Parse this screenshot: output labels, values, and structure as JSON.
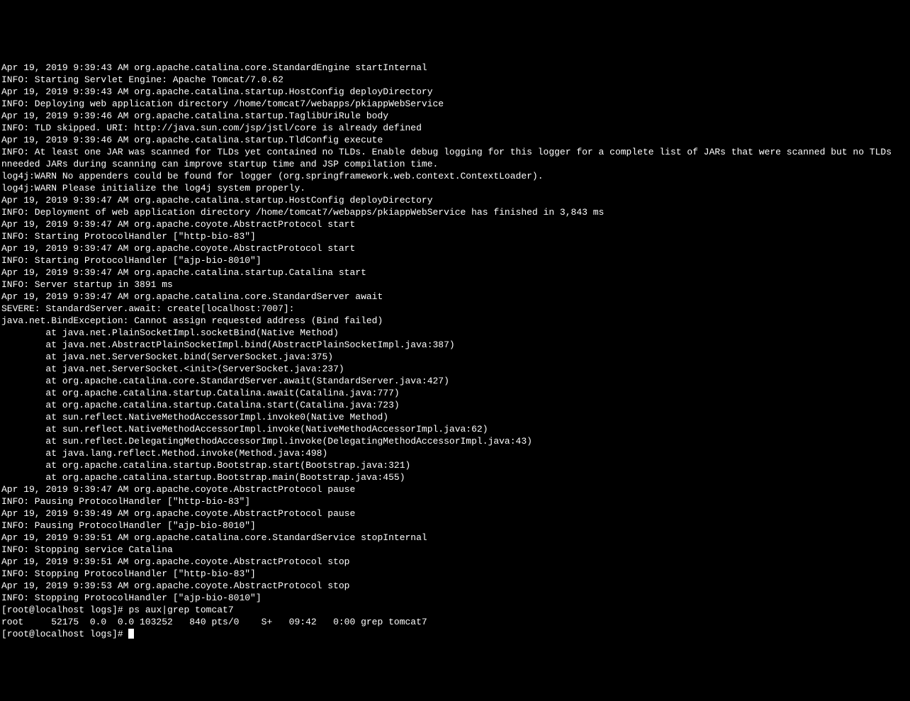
{
  "lines": [
    "Apr 19, 2019 9:39:43 AM org.apache.catalina.core.StandardEngine startInternal",
    "INFO: Starting Servlet Engine: Apache Tomcat/7.0.62",
    "Apr 19, 2019 9:39:43 AM org.apache.catalina.startup.HostConfig deployDirectory",
    "INFO: Deploying web application directory /home/tomcat7/webapps/pkiappWebService",
    "Apr 19, 2019 9:39:46 AM org.apache.catalina.startup.TaglibUriRule body",
    "INFO: TLD skipped. URI: http://java.sun.com/jsp/jstl/core is already defined",
    "Apr 19, 2019 9:39:46 AM org.apache.catalina.startup.TldConfig execute",
    "INFO: At least one JAR was scanned for TLDs yet contained no TLDs. Enable debug logging for this logger for a complete list of JARs that were scanned but no TLDs",
    "nneeded JARs during scanning can improve startup time and JSP compilation time.",
    "log4j:WARN No appenders could be found for logger (org.springframework.web.context.ContextLoader).",
    "log4j:WARN Please initialize the log4j system properly.",
    "Apr 19, 2019 9:39:47 AM org.apache.catalina.startup.HostConfig deployDirectory",
    "INFO: Deployment of web application directory /home/tomcat7/webapps/pkiappWebService has finished in 3,843 ms",
    "Apr 19, 2019 9:39:47 AM org.apache.coyote.AbstractProtocol start",
    "INFO: Starting ProtocolHandler [\"http-bio-83\"]",
    "Apr 19, 2019 9:39:47 AM org.apache.coyote.AbstractProtocol start",
    "INFO: Starting ProtocolHandler [\"ajp-bio-8010\"]",
    "Apr 19, 2019 9:39:47 AM org.apache.catalina.startup.Catalina start",
    "INFO: Server startup in 3891 ms",
    "Apr 19, 2019 9:39:47 AM org.apache.catalina.core.StandardServer await",
    "SEVERE: StandardServer.await: create[localhost:7007]:",
    "java.net.BindException: Cannot assign requested address (Bind failed)",
    "        at java.net.PlainSocketImpl.socketBind(Native Method)",
    "        at java.net.AbstractPlainSocketImpl.bind(AbstractPlainSocketImpl.java:387)",
    "        at java.net.ServerSocket.bind(ServerSocket.java:375)",
    "        at java.net.ServerSocket.<init>(ServerSocket.java:237)",
    "        at org.apache.catalina.core.StandardServer.await(StandardServer.java:427)",
    "        at org.apache.catalina.startup.Catalina.await(Catalina.java:777)",
    "        at org.apache.catalina.startup.Catalina.start(Catalina.java:723)",
    "        at sun.reflect.NativeMethodAccessorImpl.invoke0(Native Method)",
    "        at sun.reflect.NativeMethodAccessorImpl.invoke(NativeMethodAccessorImpl.java:62)",
    "        at sun.reflect.DelegatingMethodAccessorImpl.invoke(DelegatingMethodAccessorImpl.java:43)",
    "        at java.lang.reflect.Method.invoke(Method.java:498)",
    "        at org.apache.catalina.startup.Bootstrap.start(Bootstrap.java:321)",
    "        at org.apache.catalina.startup.Bootstrap.main(Bootstrap.java:455)",
    "",
    "Apr 19, 2019 9:39:47 AM org.apache.coyote.AbstractProtocol pause",
    "INFO: Pausing ProtocolHandler [\"http-bio-83\"]",
    "Apr 19, 2019 9:39:49 AM org.apache.coyote.AbstractProtocol pause",
    "INFO: Pausing ProtocolHandler [\"ajp-bio-8010\"]",
    "Apr 19, 2019 9:39:51 AM org.apache.catalina.core.StandardService stopInternal",
    "INFO: Stopping service Catalina",
    "Apr 19, 2019 9:39:51 AM org.apache.coyote.AbstractProtocol stop",
    "INFO: Stopping ProtocolHandler [\"http-bio-83\"]",
    "Apr 19, 2019 9:39:53 AM org.apache.coyote.AbstractProtocol stop",
    "INFO: Stopping ProtocolHandler [\"ajp-bio-8010\"]"
  ],
  "prompt1": {
    "prefix": "[root@localhost logs]# ",
    "command": "ps aux|grep tomcat7"
  },
  "ps_output": "root     52175  0.0  0.0 103252   840 pts/0    S+   09:42   0:00 grep tomcat7",
  "prompt2": {
    "prefix": "[root@localhost logs]# ",
    "command": ""
  }
}
